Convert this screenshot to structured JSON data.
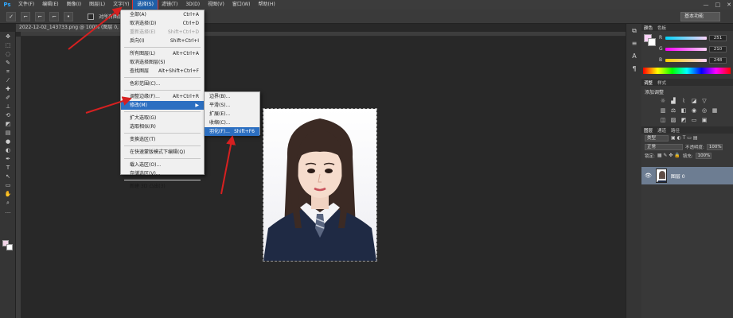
{
  "app": {
    "logo": "Ps"
  },
  "menubar": {
    "items": [
      "文件(F)",
      "编辑(E)",
      "图像(I)",
      "图层(L)",
      "文字(Y)",
      "选择(S)",
      "滤镜(T)",
      "3D(D)",
      "视图(V)",
      "窗口(W)",
      "帮助(H)"
    ]
  },
  "window_controls": {
    "minimize": "—",
    "restore": "□",
    "close": "✕"
  },
  "optionsbar": {
    "check_label": "对所有图层取样",
    "workspace": "基本功能"
  },
  "document": {
    "tab_title": "2022-12-02_143733.png @ 100% (图层 0, RGB/8)"
  },
  "select_menu": {
    "items": [
      {
        "label": "全部(A)",
        "shortcut": "Ctrl+A",
        "disabled": false
      },
      {
        "label": "取消选择(D)",
        "shortcut": "Ctrl+D",
        "disabled": false
      },
      {
        "label": "重新选择(E)",
        "shortcut": "Shift+Ctrl+D",
        "disabled": true
      },
      {
        "label": "反向(I)",
        "shortcut": "Shift+Ctrl+I",
        "disabled": false
      },
      {
        "label": "所有图层(L)",
        "shortcut": "Alt+Ctrl+A",
        "disabled": false
      },
      {
        "label": "取消选择图层(S)",
        "shortcut": "",
        "disabled": false
      },
      {
        "label": "查找图层",
        "shortcut": "Alt+Shift+Ctrl+F",
        "disabled": false
      },
      {
        "label": "色彩范围(C)...",
        "shortcut": "",
        "disabled": false
      },
      {
        "label": "调整边缘(F)...",
        "shortcut": "Alt+Ctrl+R",
        "disabled": false
      },
      {
        "label": "修改(M)",
        "shortcut": "",
        "disabled": false
      },
      {
        "label": "扩大选取(G)",
        "shortcut": "",
        "disabled": false
      },
      {
        "label": "选取相似(R)",
        "shortcut": "",
        "disabled": false
      },
      {
        "label": "变换选区(T)",
        "shortcut": "",
        "disabled": false
      },
      {
        "label": "在快速蒙版模式下编辑(Q)",
        "shortcut": "",
        "disabled": false
      },
      {
        "label": "载入选区(O)...",
        "shortcut": "",
        "disabled": false
      },
      {
        "label": "存储选区(V)...",
        "shortcut": "",
        "disabled": false
      },
      {
        "label": "新建 3D 凸出(3)",
        "shortcut": "",
        "disabled": false
      }
    ]
  },
  "modify_submenu": {
    "items": [
      {
        "label": "边界(B)...",
        "shortcut": ""
      },
      {
        "label": "平滑(S)...",
        "shortcut": ""
      },
      {
        "label": "扩展(E)...",
        "shortcut": ""
      },
      {
        "label": "收缩(C)...",
        "shortcut": ""
      },
      {
        "label": "羽化(F)...",
        "shortcut": "Shift+F6"
      }
    ]
  },
  "color_panel": {
    "tabs": [
      "颜色",
      "色板"
    ],
    "sliders": [
      {
        "label": "R",
        "value": "251"
      },
      {
        "label": "G",
        "value": "210"
      },
      {
        "label": "B",
        "value": "248"
      }
    ],
    "fg_color": "#fbd2f8"
  },
  "adjustments_panel": {
    "tabs": [
      "调整",
      "样式"
    ],
    "title": "添加调整"
  },
  "layers_panel": {
    "tabs": [
      "图层",
      "通道",
      "路径"
    ],
    "kind_filter": "类型",
    "blend_mode": "正常",
    "opacity_label": "不透明度:",
    "opacity": "100%",
    "lock_label": "锁定:",
    "fill_label": "填充:",
    "fill": "100%",
    "layer_name": "图层 0"
  },
  "colors": {
    "accent": "#2c6fc1",
    "arrow": "#d62020"
  }
}
